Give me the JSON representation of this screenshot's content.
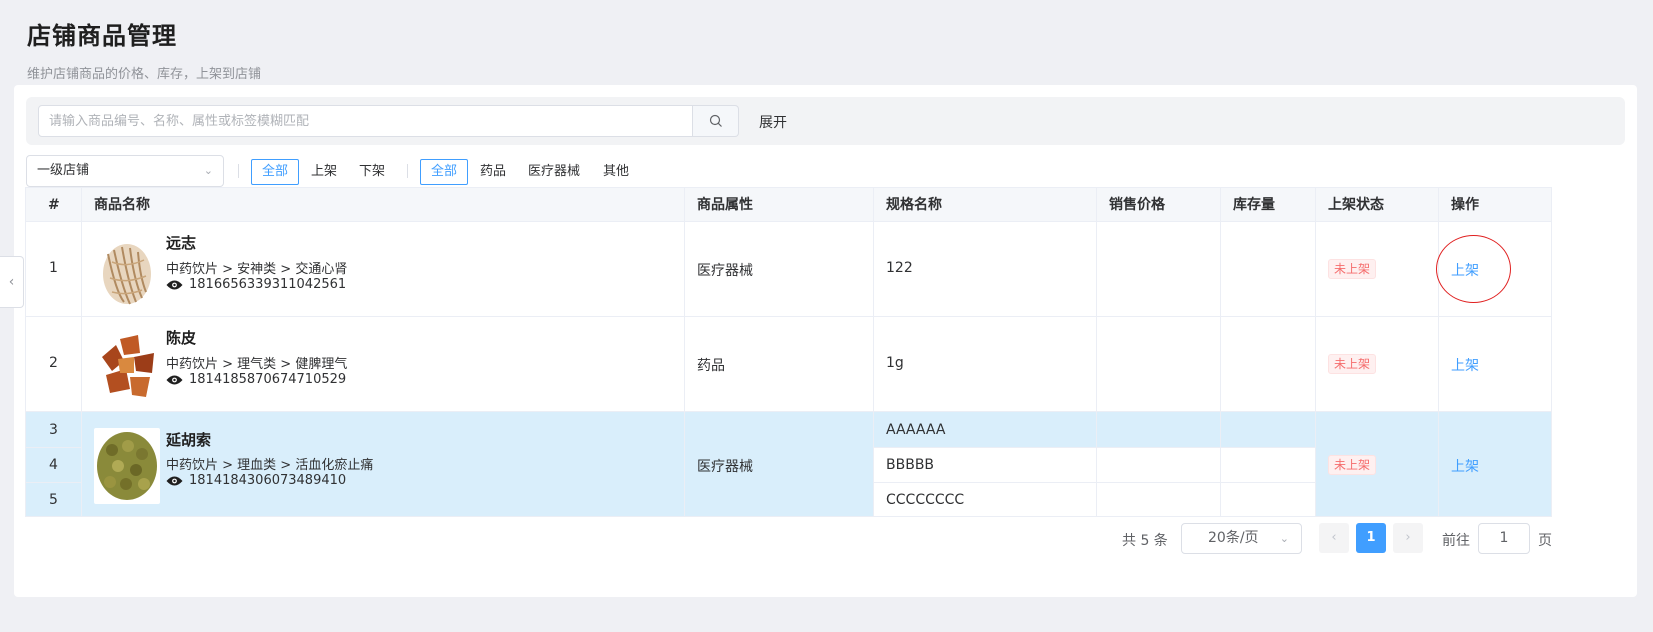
{
  "header": {
    "title": "店铺商品管理",
    "subtitle": "维护店铺商品的价格、库存，上架到店铺"
  },
  "search": {
    "placeholder": "请输入商品编号、名称、属性或标签模糊匹配",
    "expand_label": "展开"
  },
  "filters": {
    "store_select": "一级店铺",
    "status_chips": [
      "全部",
      "上架",
      "下架"
    ],
    "type_chips": [
      "全部",
      "药品",
      "医疗器械",
      "其他"
    ]
  },
  "table": {
    "columns": [
      "#",
      "商品名称",
      "商品属性",
      "规格名称",
      "销售价格",
      "库存量",
      "上架状态",
      "操作"
    ],
    "rows": [
      {
        "indexes": [
          "1"
        ],
        "name": "远志",
        "category": "中药饮片 > 安神类 > 交通心肾",
        "code": "1816656339311042561",
        "attribute": "医疗器械",
        "specs": [
          "122"
        ],
        "status": "未上架",
        "action": "上架"
      },
      {
        "indexes": [
          "2"
        ],
        "name": "陈皮",
        "category": "中药饮片 > 理气类 > 健脾理气",
        "code": "1814185870674710529",
        "attribute": "药品",
        "specs": [
          "1g"
        ],
        "status": "未上架",
        "action": "上架"
      },
      {
        "indexes": [
          "3",
          "4",
          "5"
        ],
        "name": "延胡索",
        "category": "中药饮片 > 理血类 > 活血化瘀止痛",
        "code": "1814184306073489410",
        "attribute": "医疗器械",
        "specs": [
          "AAAAAA",
          "BBBBB",
          "CCCCCCCC"
        ],
        "status": "未上架",
        "action": "上架"
      }
    ]
  },
  "pagination": {
    "total_text": "共 5 条",
    "page_size": "20条/页",
    "current_page": "1",
    "goto_label": "前往",
    "goto_value": "1",
    "page_unit": "页"
  },
  "colors": {
    "accent": "#409eff",
    "danger": "#f56c6c",
    "highlight_row": "#d9eefb"
  }
}
